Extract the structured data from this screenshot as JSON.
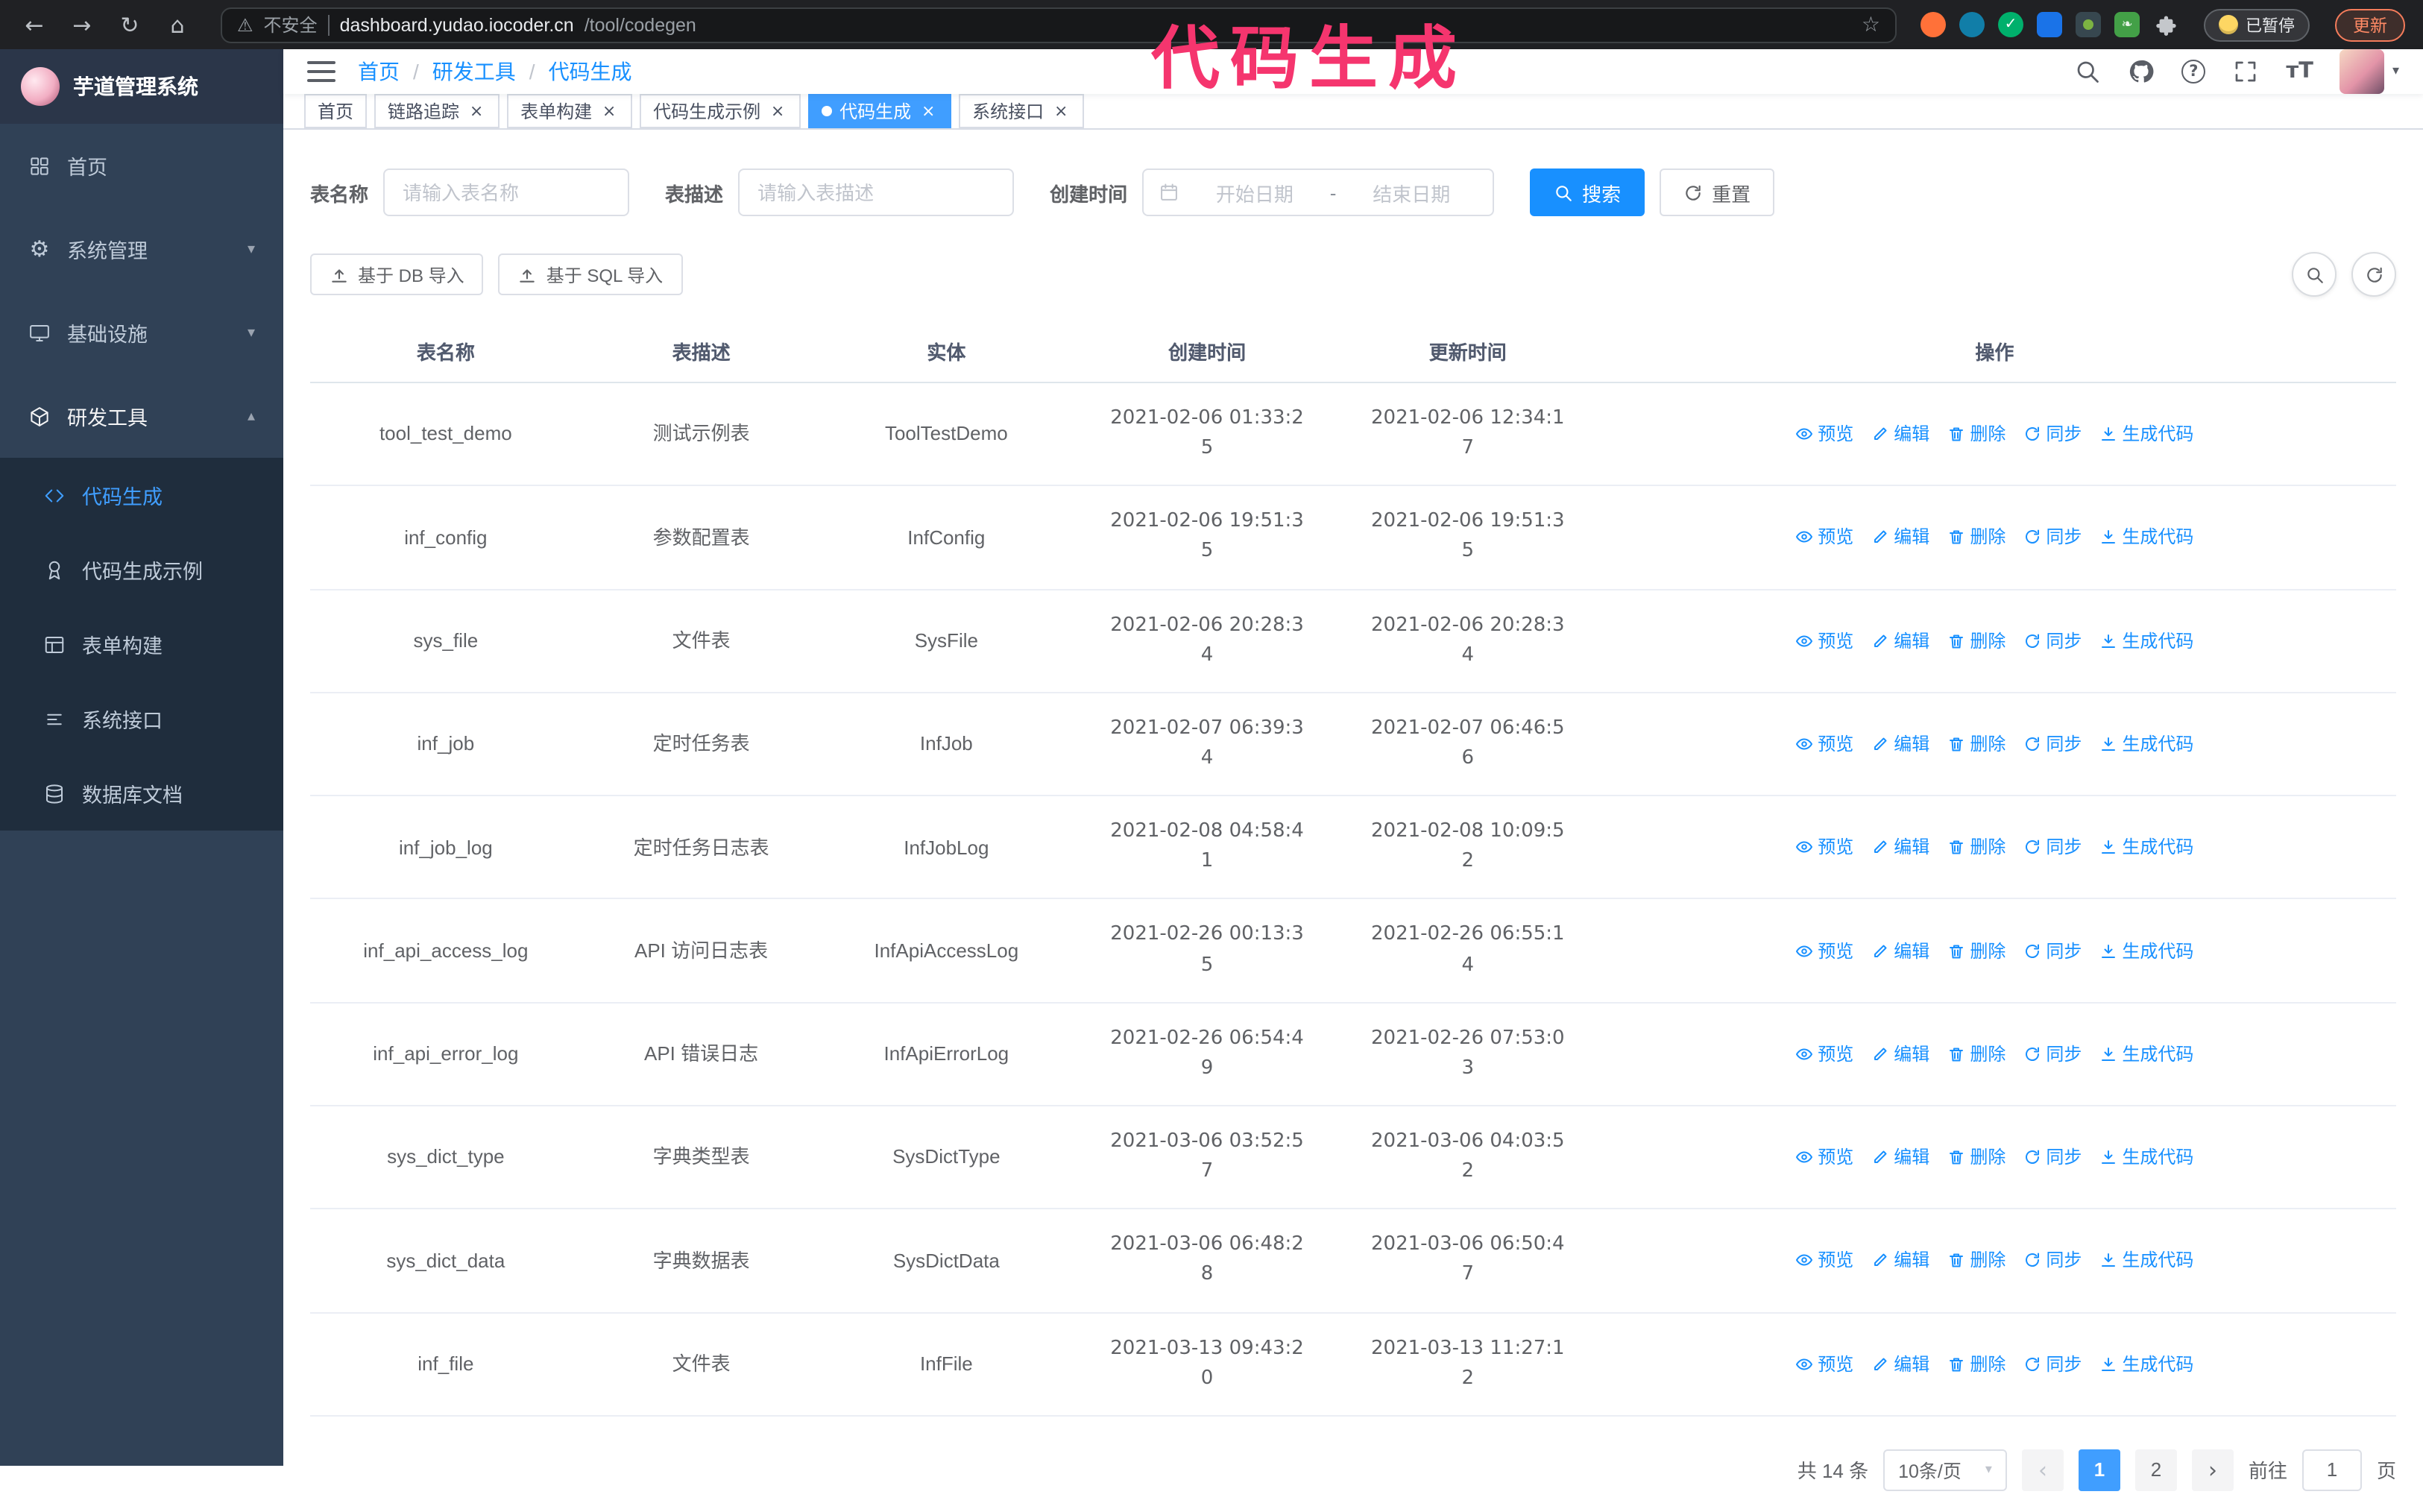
{
  "annotation": {
    "text": "代码生成",
    "color": "#f5356e"
  },
  "colors": {
    "accent": "#1890ff",
    "active_tab": "#409eff",
    "sidebar_bg": "#304156",
    "submenu_bg": "#1f2d3d",
    "annotation_pink": "#f5356e"
  },
  "browser": {
    "security_label": "不安全",
    "url_host": "dashboard.yudao.iocoder.cn",
    "url_path": "/tool/codegen",
    "paused_badge": "已暂停",
    "update_button": "更新"
  },
  "sidebar": {
    "logo_title": "芋道管理系统",
    "items": [
      {
        "label": "首页"
      },
      {
        "label": "系统管理"
      },
      {
        "label": "基础设施"
      },
      {
        "label": "研发工具"
      }
    ],
    "submenu": [
      {
        "label": "代码生成"
      },
      {
        "label": "代码生成示例"
      },
      {
        "label": "表单构建"
      },
      {
        "label": "系统接口"
      },
      {
        "label": "数据库文档"
      }
    ]
  },
  "header": {
    "breadcrumb": [
      "首页",
      "研发工具",
      "代码生成"
    ],
    "separator": "/"
  },
  "tabs": [
    {
      "label": "首页"
    },
    {
      "label": "链路追踪"
    },
    {
      "label": "表单构建"
    },
    {
      "label": "代码生成示例"
    },
    {
      "label": "代码生成"
    },
    {
      "label": "系统接口"
    }
  ],
  "filters": {
    "table_name_label": "表名称",
    "table_name_placeholder": "请输入表名称",
    "table_desc_label": "表描述",
    "table_desc_placeholder": "请输入表描述",
    "create_time_label": "创建时间",
    "start_date_placeholder": "开始日期",
    "range_separator": "-",
    "end_date_placeholder": "结束日期",
    "search_label": "搜索",
    "reset_label": "重置"
  },
  "toolbar": {
    "import_db_label": "基于 DB 导入",
    "import_sql_label": "基于 SQL 导入"
  },
  "table": {
    "columns": [
      "表名称",
      "表描述",
      "实体",
      "创建时间",
      "更新时间",
      "操作"
    ],
    "actions": [
      "预览",
      "编辑",
      "删除",
      "同步",
      "生成代码"
    ],
    "rows": [
      {
        "name": "tool_test_demo",
        "desc": "测试示例表",
        "entity": "ToolTestDemo",
        "created": "2021-02-06 01:33:25",
        "updated": "2021-02-06 12:34:17"
      },
      {
        "name": "inf_config",
        "desc": "参数配置表",
        "entity": "InfConfig",
        "created": "2021-02-06 19:51:35",
        "updated": "2021-02-06 19:51:35"
      },
      {
        "name": "sys_file",
        "desc": "文件表",
        "entity": "SysFile",
        "created": "2021-02-06 20:28:34",
        "updated": "2021-02-06 20:28:34"
      },
      {
        "name": "inf_job",
        "desc": "定时任务表",
        "entity": "InfJob",
        "created": "2021-02-07 06:39:34",
        "updated": "2021-02-07 06:46:56"
      },
      {
        "name": "inf_job_log",
        "desc": "定时任务日志表",
        "entity": "InfJobLog",
        "created": "2021-02-08 04:58:41",
        "updated": "2021-02-08 10:09:52"
      },
      {
        "name": "inf_api_access_log",
        "desc": "API 访问日志表",
        "entity": "InfApiAccessLog",
        "created": "2021-02-26 00:13:35",
        "updated": "2021-02-26 06:55:14"
      },
      {
        "name": "inf_api_error_log",
        "desc": "API 错误日志",
        "entity": "InfApiErrorLog",
        "created": "2021-02-26 06:54:49",
        "updated": "2021-02-26 07:53:03"
      },
      {
        "name": "sys_dict_type",
        "desc": "字典类型表",
        "entity": "SysDictType",
        "created": "2021-03-06 03:52:57",
        "updated": "2021-03-06 04:03:52"
      },
      {
        "name": "sys_dict_data",
        "desc": "字典数据表",
        "entity": "SysDictData",
        "created": "2021-03-06 06:48:28",
        "updated": "2021-03-06 06:50:47"
      },
      {
        "name": "inf_file",
        "desc": "文件表",
        "entity": "InfFile",
        "created": "2021-03-13 09:43:20",
        "updated": "2021-03-13 11:27:12"
      }
    ]
  },
  "pagination": {
    "total_label": "共 14 条",
    "page_size": "10条/页",
    "pages": [
      "1",
      "2"
    ],
    "goto_label": "前往",
    "goto_value": "1",
    "page_unit": "页"
  }
}
